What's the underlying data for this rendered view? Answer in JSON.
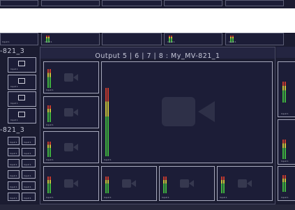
{
  "window": {
    "output_title": "Output 5 | 6 | 7 | 8 : My_MV-821_1",
    "left_label_top": "-821_3",
    "left_label_bottom": "-821_3"
  },
  "tiles": {
    "input_label": "Input 1"
  },
  "colors": {
    "background": "#1b1c31",
    "tile_fill": "#1c1d37",
    "tile_border": "#a7a9bd",
    "meter_green": "#3fb23f",
    "meter_yellow": "#c9c33a",
    "meter_red": "#c23a2e"
  },
  "icons": {
    "camera": "video-camera-icon"
  }
}
